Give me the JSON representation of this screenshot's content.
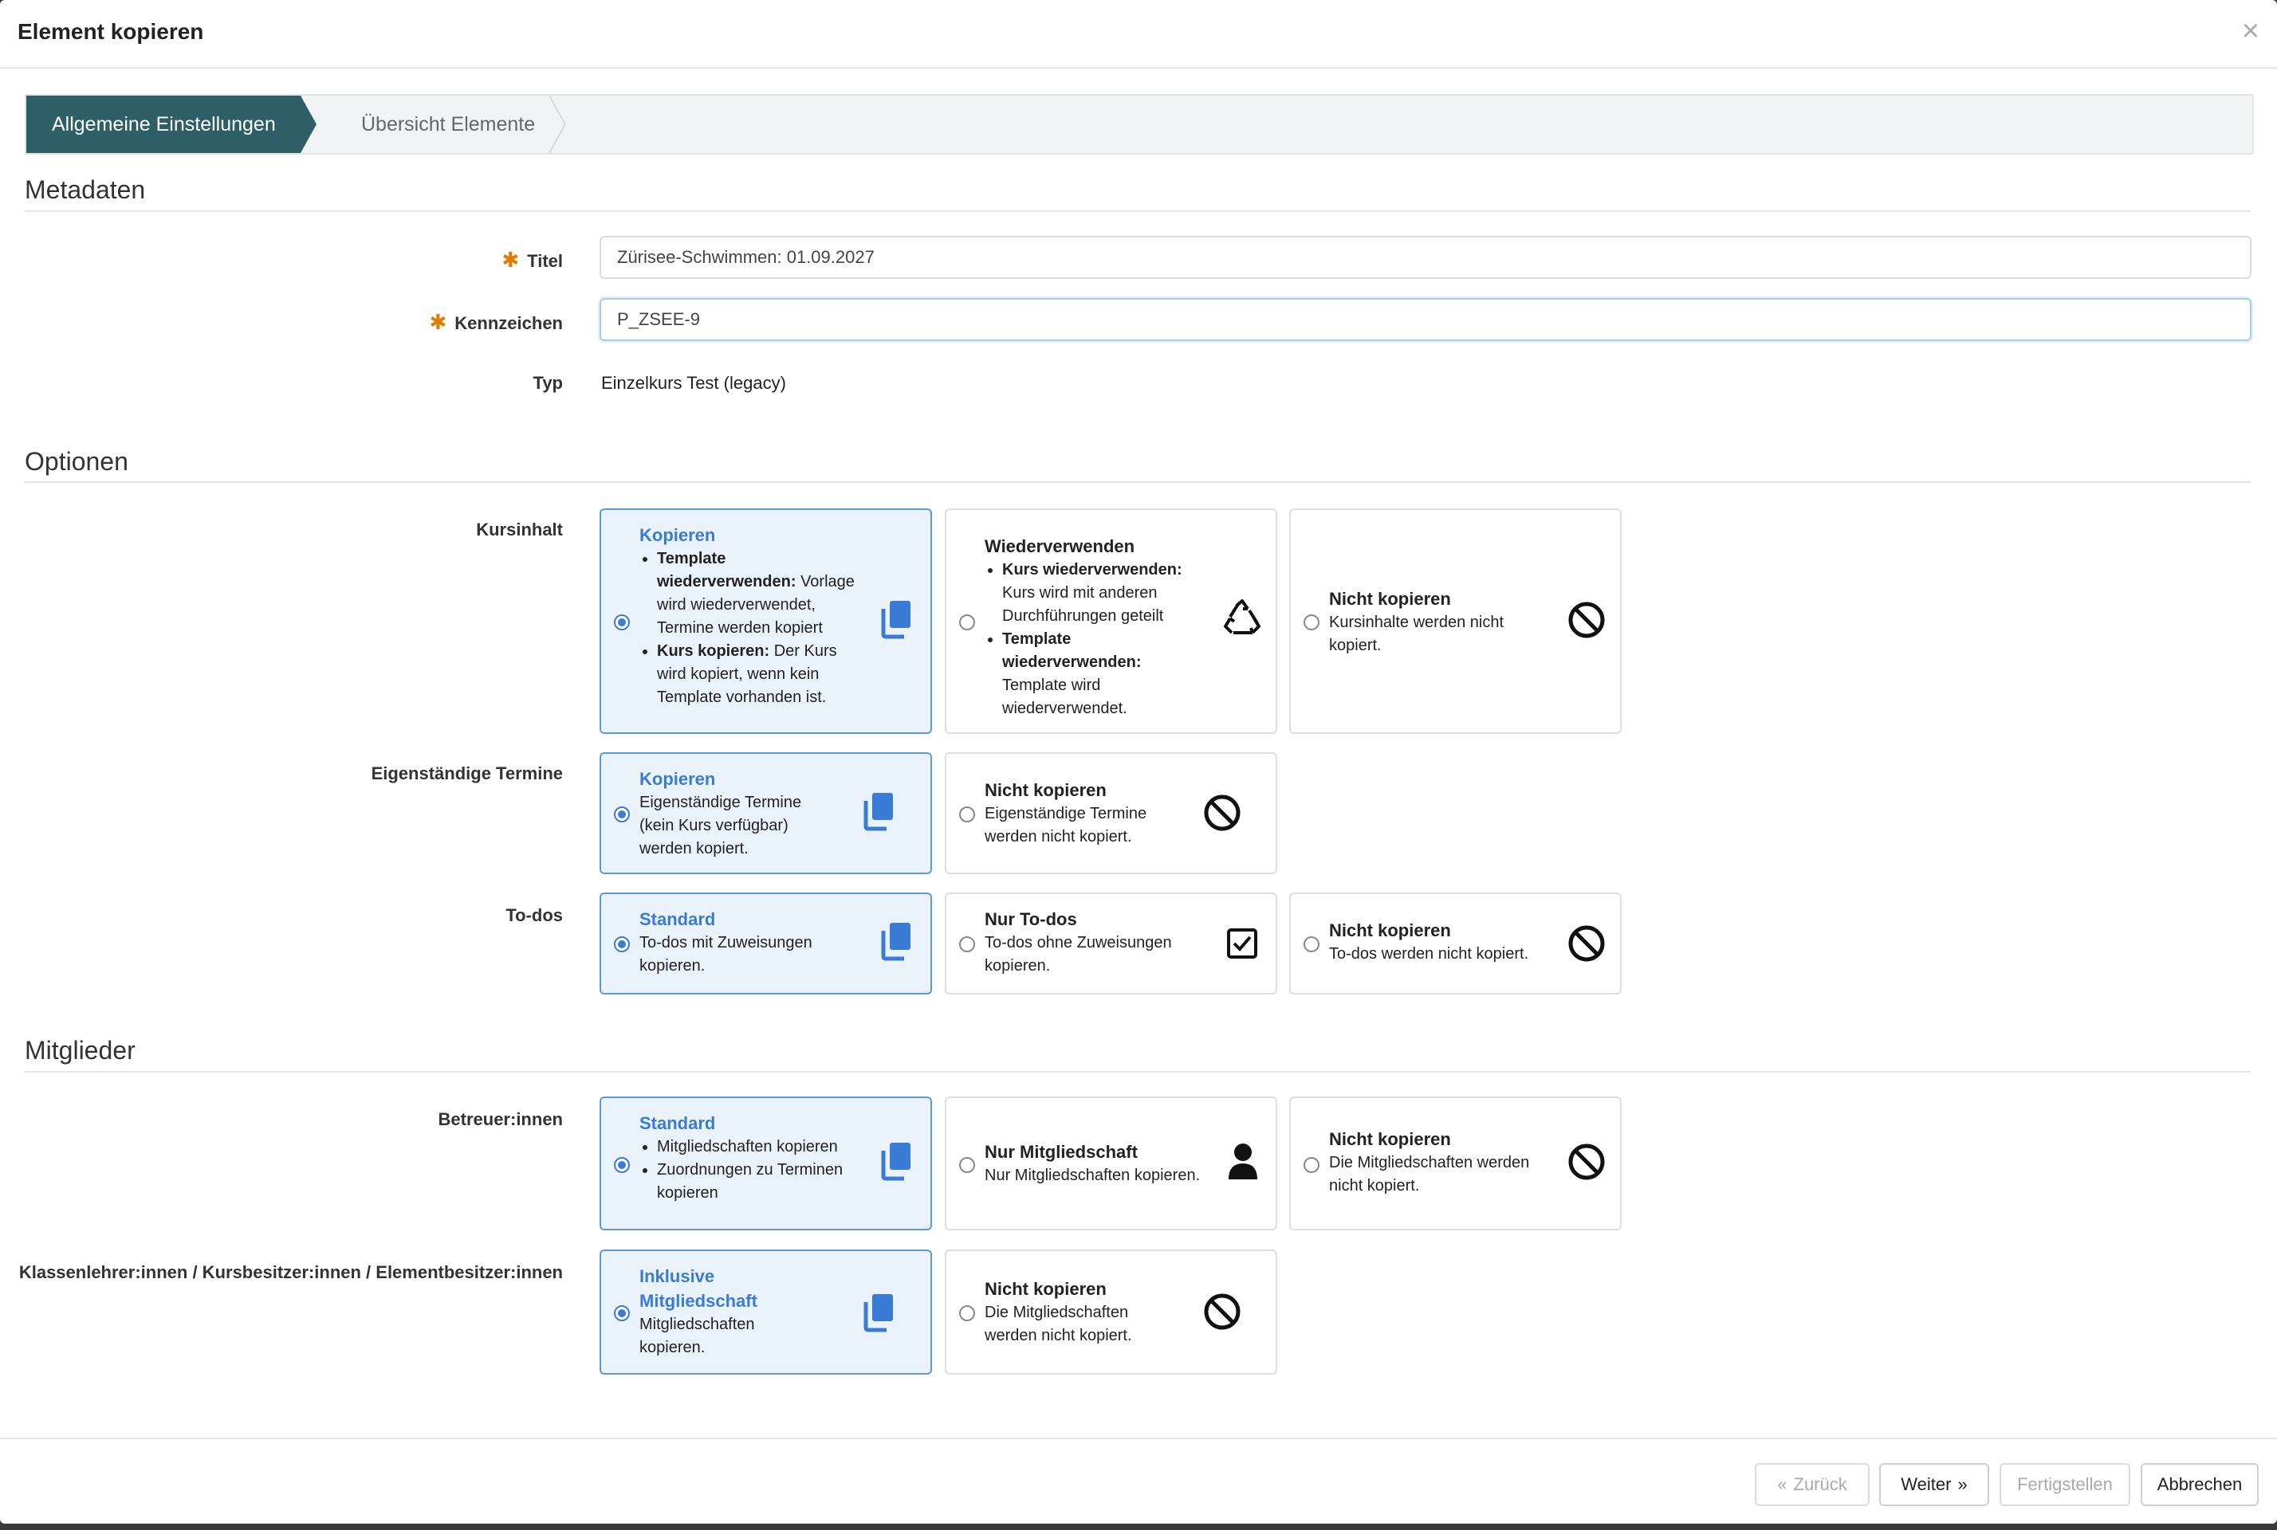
{
  "dialog": {
    "title": "Element kopieren",
    "close": "×"
  },
  "wizard": {
    "step1": "Allgemeine Einstellungen",
    "step2": "Übersicht Elemente"
  },
  "metadata": {
    "section": "Metadaten",
    "title_label": "Titel",
    "title_value": "Zürisee-Schwimmen: 01.09.2027",
    "code_label": "Kennzeichen",
    "code_value": "P_ZSEE-9",
    "type_label": "Typ",
    "type_value": "Einzelkurs Test (legacy)"
  },
  "options": {
    "section": "Optionen",
    "kursinhalt": {
      "label": "Kursinhalt",
      "copy": {
        "title": "Kopieren",
        "b1_bold": "Template wiederverwenden:",
        "b1_text": " Vorlage wird wiederverwendet, Termine werden kopiert",
        "b2_bold": "Kurs kopieren:",
        "b2_text": " Der Kurs wird kopiert, wenn kein Template vorhanden ist."
      },
      "reuse": {
        "title": "Wiederverwenden",
        "b1_bold": "Kurs wiederverwenden:",
        "b1_text": " Kurs wird mit anderen Durchführungen geteilt",
        "b2_bold": "Template wiederverwenden:",
        "b2_text": " Template wird wiederverwendet."
      },
      "none": {
        "title": "Nicht kopieren",
        "desc": "Kursinhalte werden nicht kopiert."
      }
    },
    "termine": {
      "label": "Eigenständige Termine",
      "copy": {
        "title": "Kopieren",
        "desc": "Eigenständige Termine (kein Kurs verfügbar) werden kopiert."
      },
      "none": {
        "title": "Nicht kopieren",
        "desc": "Eigenständige Termine werden nicht kopiert."
      }
    },
    "todos": {
      "label": "To-dos",
      "standard": {
        "title": "Standard",
        "desc": "To-dos mit Zuweisungen kopieren."
      },
      "only": {
        "title": "Nur To-dos",
        "desc": "To-dos ohne Zuweisungen kopieren."
      },
      "none": {
        "title": "Nicht kopieren",
        "desc": "To-dos werden nicht kopiert."
      }
    }
  },
  "members": {
    "section": "Mitglieder",
    "betreuer": {
      "label": "Betreuer:innen",
      "standard": {
        "title": "Standard",
        "b1": "Mitgliedschaften kopieren",
        "b2": "Zuordnungen zu Terminen kopieren"
      },
      "only": {
        "title": "Nur Mitgliedschaft",
        "desc": "Nur Mitgliedschaften kopieren."
      },
      "none": {
        "title": "Nicht kopieren",
        "desc": "Die Mitgliedschaften werden nicht kopiert."
      }
    },
    "owners": {
      "label": "Klassenlehrer:innen / Kursbesitzer:innen / Elementbesitzer:innen",
      "incl": {
        "title": "Inklusive Mitgliedschaft",
        "desc": "Mitgliedschaften kopieren."
      },
      "none": {
        "title": "Nicht kopieren",
        "desc": "Die Mitgliedschaften werden nicht kopiert."
      }
    }
  },
  "footer": {
    "back": "Zurück",
    "next": "Weiter",
    "finish": "Fertigstellen",
    "cancel": "Abbrechen"
  }
}
